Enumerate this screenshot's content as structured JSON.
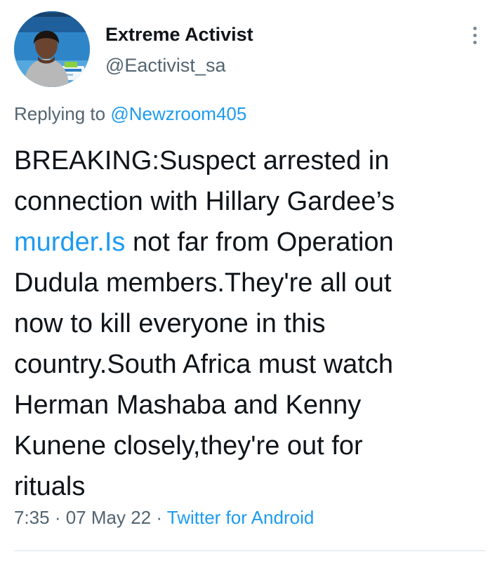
{
  "author": {
    "name": "Extreme Activist",
    "handle": "@Eactivist_sa"
  },
  "reply": {
    "prefix": "Replying to ",
    "mention": "@Newzroom405"
  },
  "tweet": {
    "line1": "BREAKING:Suspect arrested in",
    "line2": "connection with Hillary Gardee’s",
    "line3_link": "murder.Is",
    "line3_rest": " not far from Operation",
    "line4": "Dudula members.They're all out",
    "line5": "now to kill everyone in this",
    "line6": "country.South Africa must watch",
    "line7": "Herman Mashaba and Kenny",
    "line8": "Kunene closely,they're out for",
    "line9": "rituals"
  },
  "meta": {
    "time": "7:35",
    "separator": " · ",
    "date": "07 May 22",
    "source": "Twitter for Android"
  },
  "colors": {
    "link": "#1d9bf0",
    "secondary_text": "#536471",
    "primary_text": "#0f1419"
  },
  "icons": {
    "more": "more-vertical-icon"
  }
}
